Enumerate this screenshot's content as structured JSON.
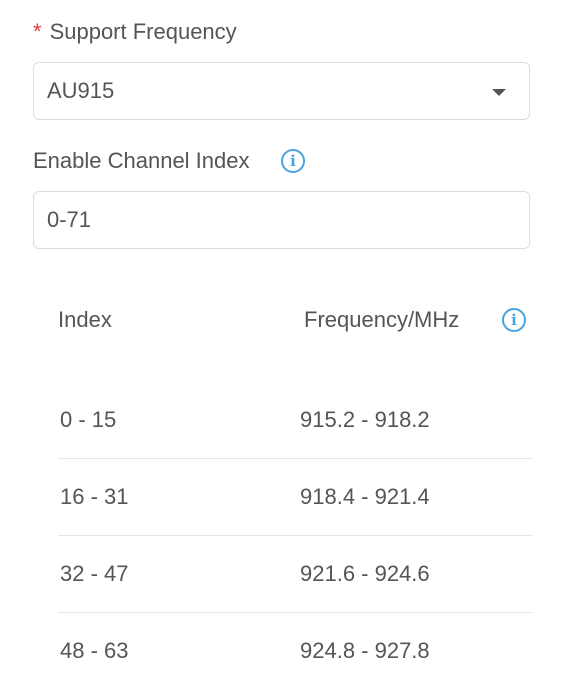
{
  "support_frequency": {
    "required_mark": "*",
    "label": "Support Frequency",
    "selected_value": "AU915"
  },
  "channel_index": {
    "label": "Enable Channel Index",
    "value": "0-71",
    "info_icon": "info-icon"
  },
  "table": {
    "headers": {
      "index": "Index",
      "frequency": "Frequency/MHz"
    },
    "info_icon": "info-icon",
    "rows": [
      {
        "index": "0 - 15",
        "frequency": "915.2 - 918.2"
      },
      {
        "index": "16 - 31",
        "frequency": "918.4 - 921.4"
      },
      {
        "index": "32 - 47",
        "frequency": "921.6 - 924.6"
      },
      {
        "index": "48 - 63",
        "frequency": "924.8 - 927.8"
      }
    ]
  },
  "colors": {
    "accent": "#4aa3df",
    "required": "#e53935",
    "text": "#555555",
    "border": "#dcdcdc"
  }
}
